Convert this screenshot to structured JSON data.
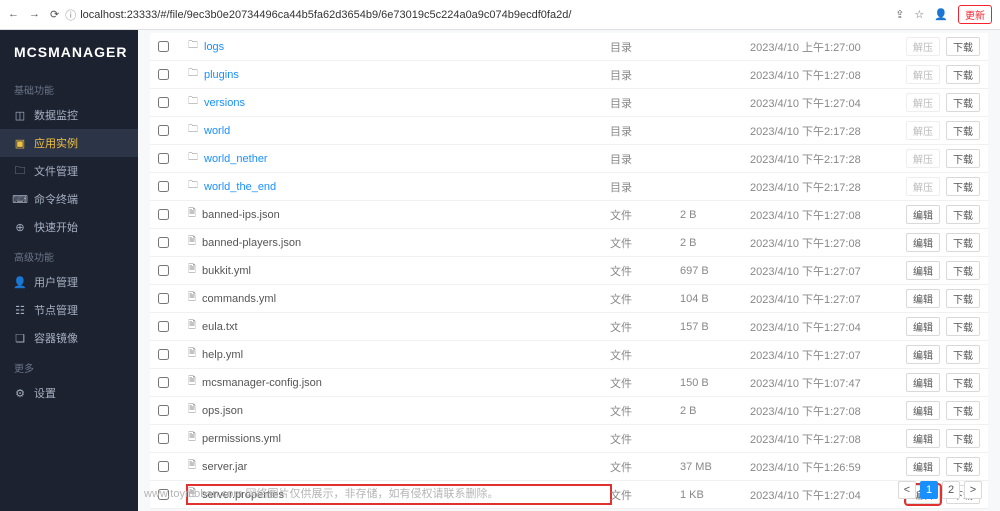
{
  "browser": {
    "url": "localhost:23333/#/file/9ec3b0e20734496ca44b5fa62d3654b9/6e73019c5c224a0a9c074b9ecdf0fa2d/",
    "update_btn": "更新"
  },
  "brand": "MCSMANAGER",
  "sidebar": {
    "group_basic": "基础功能",
    "group_advanced": "高级功能",
    "group_more": "更多",
    "items": [
      {
        "icon": "◫",
        "label": "数据监控"
      },
      {
        "icon": "▣",
        "label": "应用实例"
      },
      {
        "icon": "🗀",
        "label": "文件管理"
      },
      {
        "icon": "⌨",
        "label": "命令终端"
      },
      {
        "icon": "⊕",
        "label": "快速开始"
      },
      {
        "icon": "👤",
        "label": "用户管理"
      },
      {
        "icon": "☷",
        "label": "节点管理"
      },
      {
        "icon": "❏",
        "label": "容器镜像"
      },
      {
        "icon": "⚙",
        "label": "设置"
      }
    ]
  },
  "type_labels": {
    "dir": "目录",
    "file": "文件"
  },
  "action_labels": {
    "unzip": "解压",
    "edit": "编辑",
    "download": "下载"
  },
  "files": [
    {
      "name": "logs",
      "is_dir": true,
      "link": true,
      "size": "",
      "date": "2023/4/10 上午1:27:00",
      "a1": "unzip",
      "a1d": true
    },
    {
      "name": "plugins",
      "is_dir": true,
      "link": true,
      "size": "",
      "date": "2023/4/10 下午1:27:08",
      "a1": "unzip",
      "a1d": true
    },
    {
      "name": "versions",
      "is_dir": true,
      "link": true,
      "size": "",
      "date": "2023/4/10 下午1:27:04",
      "a1": "unzip",
      "a1d": true
    },
    {
      "name": "world",
      "is_dir": true,
      "link": true,
      "size": "",
      "date": "2023/4/10 下午2:17:28",
      "a1": "unzip",
      "a1d": true
    },
    {
      "name": "world_nether",
      "is_dir": true,
      "link": true,
      "size": "",
      "date": "2023/4/10 下午2:17:28",
      "a1": "unzip",
      "a1d": true
    },
    {
      "name": "world_the_end",
      "is_dir": true,
      "link": true,
      "size": "",
      "date": "2023/4/10 下午2:17:28",
      "a1": "unzip",
      "a1d": true
    },
    {
      "name": "banned-ips.json",
      "is_dir": false,
      "link": false,
      "size": "2 B",
      "date": "2023/4/10 下午1:27:08",
      "a1": "edit"
    },
    {
      "name": "banned-players.json",
      "is_dir": false,
      "link": false,
      "size": "2 B",
      "date": "2023/4/10 下午1:27:08",
      "a1": "edit"
    },
    {
      "name": "bukkit.yml",
      "is_dir": false,
      "link": false,
      "size": "697 B",
      "date": "2023/4/10 下午1:27:07",
      "a1": "edit"
    },
    {
      "name": "commands.yml",
      "is_dir": false,
      "link": false,
      "size": "104 B",
      "date": "2023/4/10 下午1:27:07",
      "a1": "edit"
    },
    {
      "name": "eula.txt",
      "is_dir": false,
      "link": false,
      "size": "157 B",
      "date": "2023/4/10 下午1:27:04",
      "a1": "edit"
    },
    {
      "name": "help.yml",
      "is_dir": false,
      "link": false,
      "size": "",
      "date": "2023/4/10 下午1:27:07",
      "a1": "edit"
    },
    {
      "name": "mcsmanager-config.json",
      "is_dir": false,
      "link": false,
      "size": "150 B",
      "date": "2023/4/10 下午1:07:47",
      "a1": "edit"
    },
    {
      "name": "ops.json",
      "is_dir": false,
      "link": false,
      "size": "2 B",
      "date": "2023/4/10 下午1:27:08",
      "a1": "edit"
    },
    {
      "name": "permissions.yml",
      "is_dir": false,
      "link": false,
      "size": "",
      "date": "2023/4/10 下午1:27:08",
      "a1": "edit"
    },
    {
      "name": "server.jar",
      "is_dir": false,
      "link": false,
      "size": "37 MB",
      "date": "2023/4/10 下午1:26:59",
      "a1": "edit"
    },
    {
      "name": "server.properties",
      "is_dir": false,
      "link": false,
      "size": "1 KB",
      "date": "2023/4/10 下午1:27:04",
      "a1": "edit",
      "hl_name": true,
      "hl_a1": true
    }
  ],
  "pagination": {
    "prev": "<",
    "page1": "1",
    "page2": "2",
    "next": ">"
  },
  "watermark": "www.toymoban.com  网络图片仅供展示，非存储，如有侵权请联系删除。"
}
